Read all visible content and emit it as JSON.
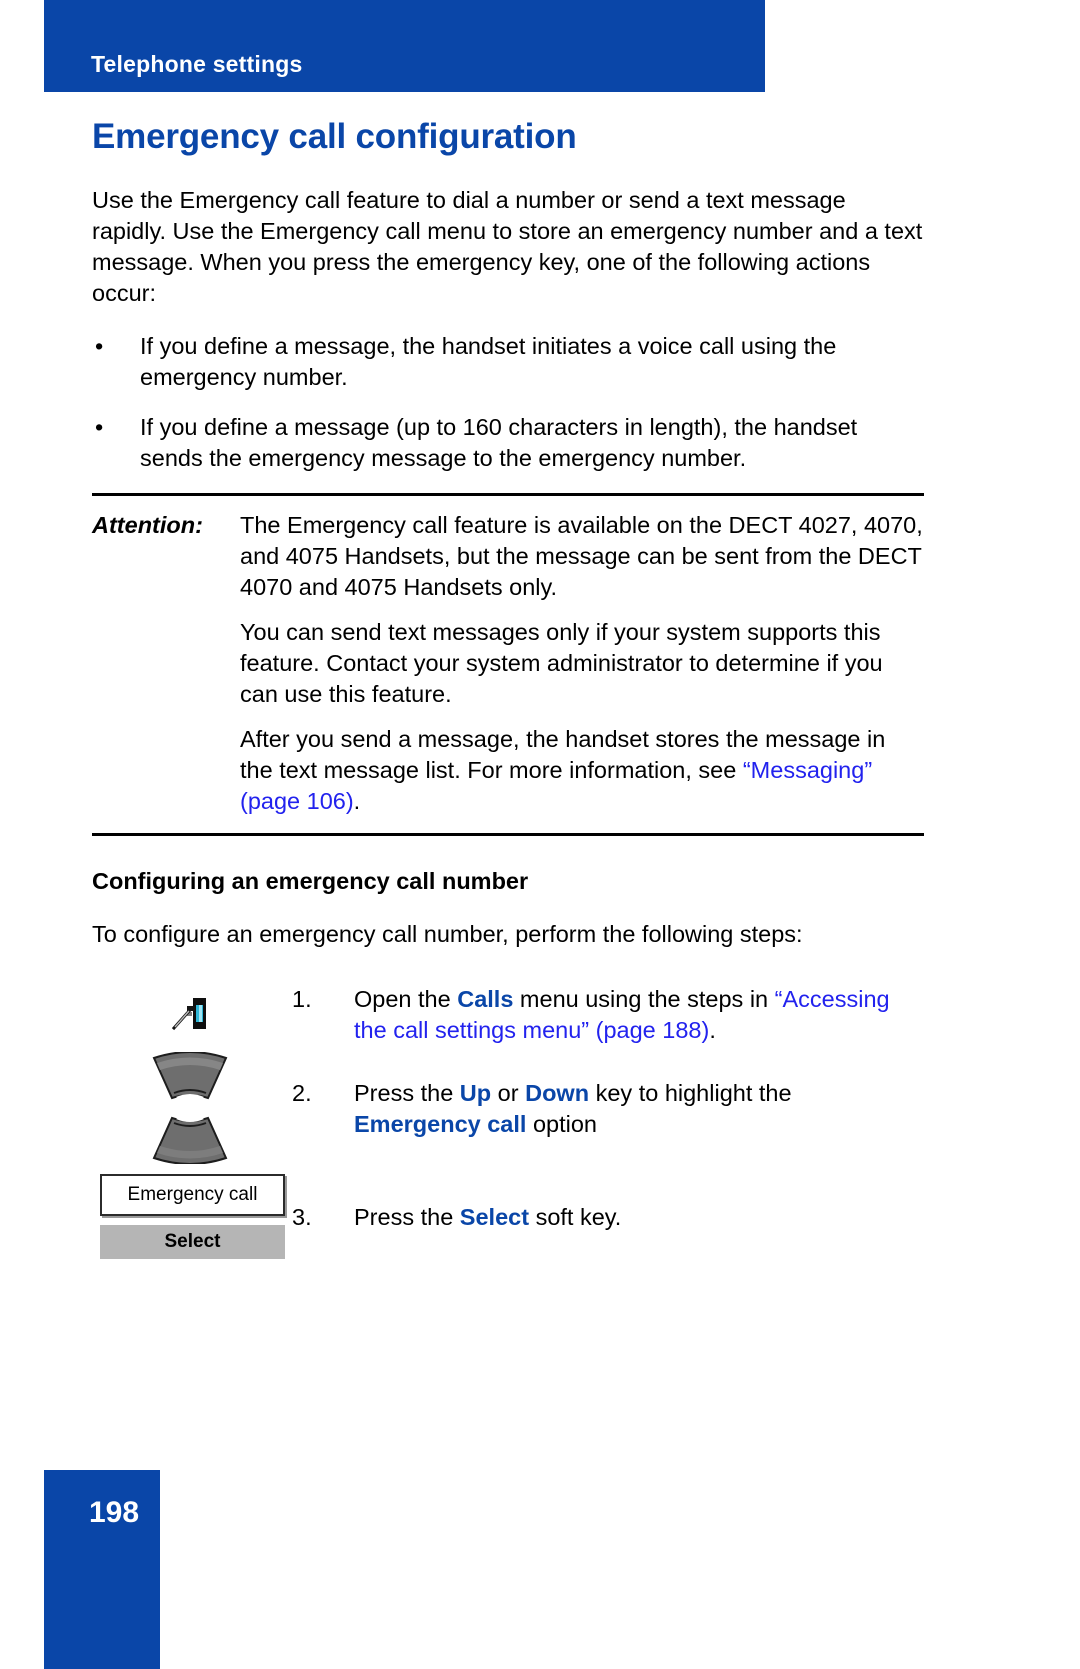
{
  "header": {
    "running_head": "Telephone settings",
    "banner_color": "#0A46A8"
  },
  "page": {
    "title": "Emergency call configuration",
    "title_color": "#0A46A8",
    "number": "198"
  },
  "intro": {
    "paragraph": "Use the Emergency call feature to dial a number or send a text message rapidly. Use the Emergency call menu to store an emergency number and a text message. When you press the emergency key, one of the following actions occur:"
  },
  "bullets": {
    "marker": "•",
    "items": [
      "If you define a message, the handset initiates a voice call using the emergency number.",
      "If you define a message (up to 160 characters in length), the handset sends the emergency message to the emergency number."
    ]
  },
  "attention": {
    "label": "Attention:",
    "paragraphs": [
      "The Emergency call feature is available on the DECT 4027, 4070, and 4075 Handsets, but the message can be sent from the DECT 4070 and 4075 Handsets only.",
      "You can send text messages only if your system supports this feature. Contact your system administrator to determine if you can use this feature."
    ],
    "last_paragraph": {
      "lead": "After you send a message, the handset stores the message in the text message list. For more information, see ",
      "link": "“Messaging” (page 106)",
      "tail": ".",
      "link_color": "#2222EE"
    }
  },
  "section": {
    "sub_head": "Configuring an emergency call number",
    "lead_in": "To configure an emergency call number, perform the following steps:"
  },
  "steps": [
    {
      "num": "1.",
      "part1": "Open the ",
      "bold1": "Calls",
      "part2": " menu using the steps in ",
      "link": "“Accessing the call settings menu” (page 188)",
      "tail": "."
    },
    {
      "num": "2.",
      "part1": "Press the ",
      "bold1": "Up",
      "part2": " or ",
      "bold2": "Down",
      "part3": " key to highlight the ",
      "bold3": "Emergency call",
      "tail": " option"
    },
    {
      "num": "3.",
      "part1": "Press the ",
      "bold1": "Select",
      "tail": " soft key."
    }
  ],
  "artwork": {
    "calls_icon_name": "calls-menu-icon",
    "calls_icon_accent": "#2FB6D6",
    "nav_up_name": "navigation-key-up",
    "nav_down_name": "navigation-key-down",
    "nav_key_color": "#6e6e6e",
    "handset_display_text": "Emergency call",
    "soft_key_label": "Select",
    "soft_key_bg": "#b5b5b5"
  }
}
